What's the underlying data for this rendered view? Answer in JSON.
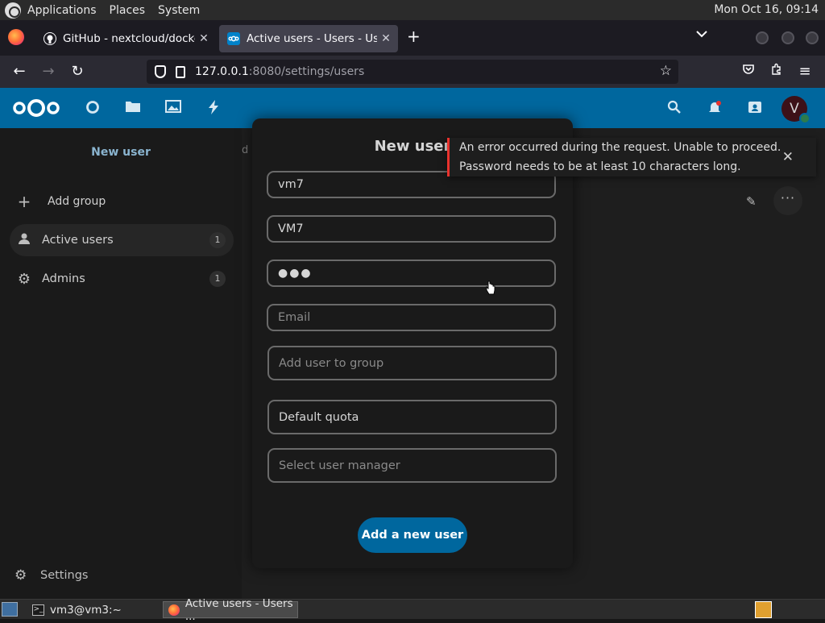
{
  "system_panel": {
    "menus": [
      "Applications",
      "Places",
      "System"
    ],
    "clock": "Mon Oct 16, 09:14"
  },
  "browser": {
    "tabs": [
      {
        "title": "GitHub - nextcloud/docker:",
        "active": false
      },
      {
        "title": "Active users - Users - Users",
        "active": true
      }
    ],
    "url_host": "127.0.0.1",
    "url_rest": ":8080/settings/users"
  },
  "sidebar": {
    "new_user_label": "New user",
    "add_group_label": "Add group",
    "items": [
      {
        "label": "Active users",
        "count": "1"
      },
      {
        "label": "Admins",
        "count": "1"
      }
    ],
    "settings_label": "Settings"
  },
  "column_peek": "d",
  "modal": {
    "title": "New user",
    "fields": {
      "username": {
        "value": "vm7"
      },
      "display_name": {
        "value": "VM7"
      },
      "password": {
        "value": "●●●"
      },
      "email": {
        "placeholder": "Email"
      },
      "groups": {
        "placeholder": "Add user to group"
      },
      "quota": {
        "value": "Default quota"
      },
      "manager": {
        "placeholder": "Select user manager"
      }
    },
    "submit_label": "Add a new user"
  },
  "toast": {
    "line1": "An error occurred during the request. Unable to proceed.",
    "line2": "Password needs to be at least 10 characters long."
  },
  "user_avatar_initial": "V",
  "taskbar": {
    "items": [
      {
        "label": "vm3@vm3:~"
      },
      {
        "label": "Active users - Users ..."
      }
    ]
  },
  "colors": {
    "nextcloud_blue": "#00679e",
    "error_red": "#e9322d",
    "status_online": "#2d7b4c"
  }
}
